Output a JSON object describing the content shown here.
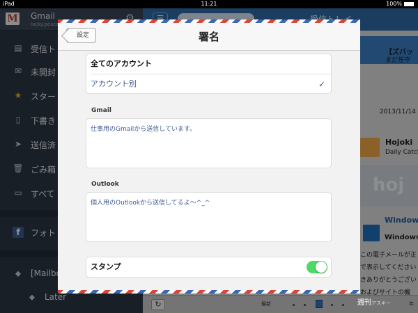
{
  "status_bar": {
    "device": "iPad",
    "time": "11:21",
    "battery": "100%"
  },
  "sidebar": {
    "account_name": "Gmail",
    "account_email": "lucky.peace.i",
    "items": [
      {
        "label": "受信ト",
        "icon": "inbox-icon"
      },
      {
        "label": "未開封",
        "icon": "envelope-icon"
      },
      {
        "label": "スター",
        "icon": "star-icon"
      },
      {
        "label": "下書き",
        "icon": "document-icon"
      },
      {
        "label": "送信済",
        "icon": "paper-plane-icon"
      },
      {
        "label": "ごみ箱",
        "icon": "trash-icon"
      },
      {
        "label": "すべて",
        "icon": "archive-icon"
      }
    ],
    "facebook_label": "フォト",
    "folders": [
      {
        "label": "[Mailbo"
      },
      {
        "label": "Later"
      }
    ]
  },
  "right_pane": {
    "title": "受信トレイ",
    "msg1_title": "【ズバッ",
    "msg1_sub": "まだ任守",
    "date": "2013/11/14",
    "msg2_title": "Hojoki",
    "msg2_sub": "Daily Catch-U",
    "banner_text": "hoj",
    "msg3_title": "Windows",
    "msg3_sub": "Windows Az",
    "body_lines": [
      "この電子メールが正",
      "で表示してください",
      "きありがとうござい",
      "およびサイトの機"
    ],
    "bottom_latest": "最新",
    "bottom_year": "年",
    "watermark": "週刊",
    "watermark_sub": "アスキー"
  },
  "modal": {
    "back_label": "設定",
    "title": "署名",
    "options": [
      {
        "label": "全てのアカウント",
        "selected": false
      },
      {
        "label": "アカウント別",
        "selected": true
      }
    ],
    "checkmark": "✓",
    "gmail_label": "Gmail",
    "gmail_signature": "仕事用のGmailから送信しています。",
    "outlook_label": "Outlook",
    "outlook_signature": "個人用のOutlookから送信してるよ〜^_^",
    "stamp_label": "スタンプ",
    "stamp_on": true
  },
  "colors": {
    "toggle_on": "#4cd964",
    "accent_blue": "#3d5c91",
    "stripe_red": "#d9463b",
    "stripe_blue": "#3c67b5"
  }
}
